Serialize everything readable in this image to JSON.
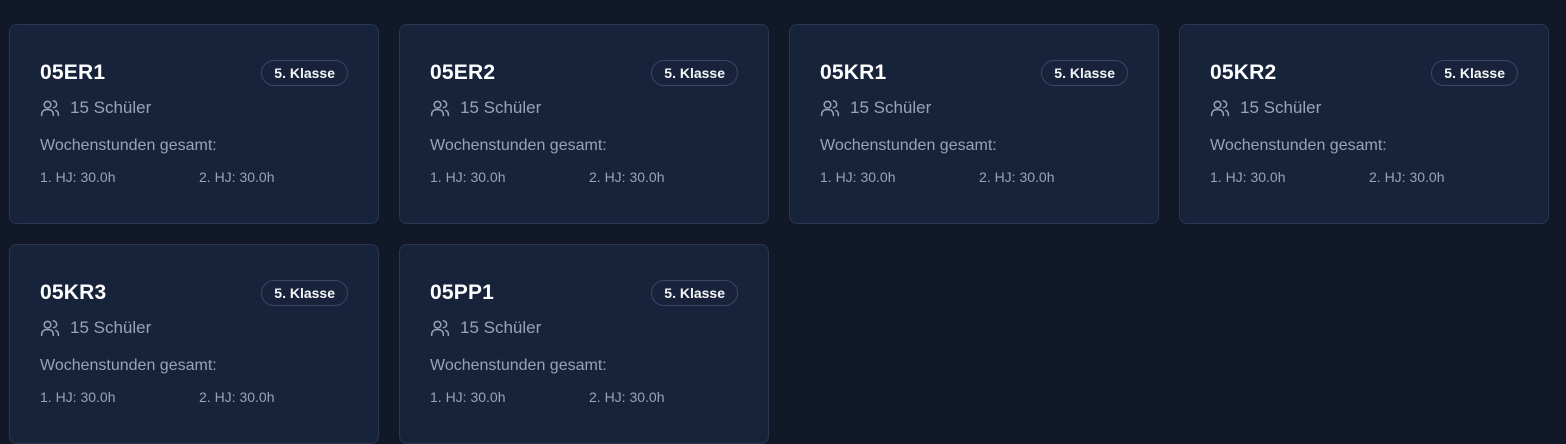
{
  "hours_title": "Wochenstunden gesamt:",
  "colors": {
    "background": "#111827",
    "card": "#17223b",
    "border": "#2b3650",
    "text_primary": "#ffffff",
    "text_muted": "#9aa3b5"
  },
  "icons": {
    "students": "users-icon"
  },
  "classes": [
    {
      "name": "05ER1",
      "grade": "5. Klasse",
      "students": "15 Schüler",
      "hj1": "1. HJ: 30.0h",
      "hj2": "2. HJ: 30.0h"
    },
    {
      "name": "05ER2",
      "grade": "5. Klasse",
      "students": "15 Schüler",
      "hj1": "1. HJ: 30.0h",
      "hj2": "2. HJ: 30.0h"
    },
    {
      "name": "05KR1",
      "grade": "5. Klasse",
      "students": "15 Schüler",
      "hj1": "1. HJ: 30.0h",
      "hj2": "2. HJ: 30.0h"
    },
    {
      "name": "05KR2",
      "grade": "5. Klasse",
      "students": "15 Schüler",
      "hj1": "1. HJ: 30.0h",
      "hj2": "2. HJ: 30.0h"
    },
    {
      "name": "05KR3",
      "grade": "5. Klasse",
      "students": "15 Schüler",
      "hj1": "1. HJ: 30.0h",
      "hj2": "2. HJ: 30.0h"
    },
    {
      "name": "05PP1",
      "grade": "5. Klasse",
      "students": "15 Schüler",
      "hj1": "1. HJ: 30.0h",
      "hj2": "2. HJ: 30.0h"
    }
  ]
}
